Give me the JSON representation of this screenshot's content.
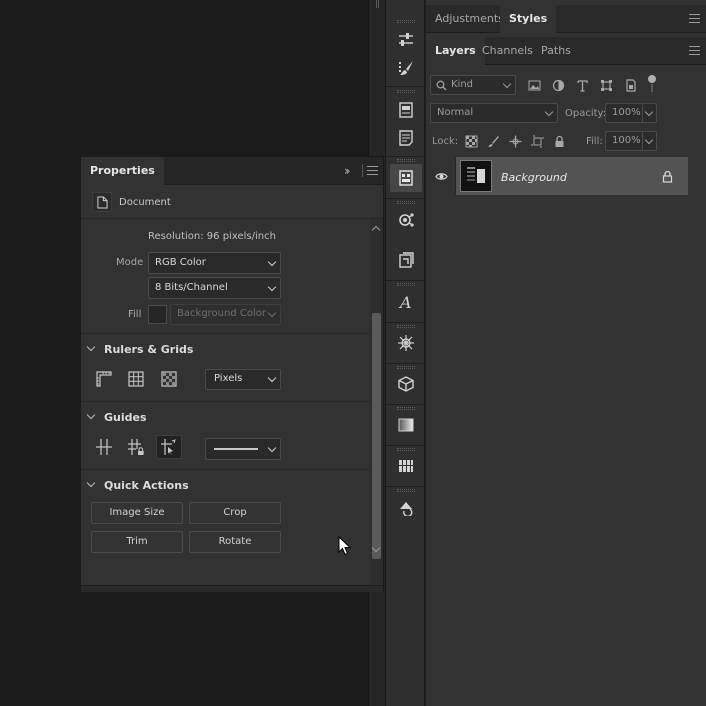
{
  "right_panel": {
    "top_tabs": [
      {
        "label": "Adjustments",
        "active": false
      },
      {
        "label": "Styles",
        "active": true
      }
    ],
    "layer_tabs": [
      {
        "label": "Layers",
        "active": true
      },
      {
        "label": "Channels",
        "active": false
      },
      {
        "label": "Paths",
        "active": false
      }
    ],
    "filter": {
      "kind_label": "Kind",
      "icons": [
        "image-filter-icon",
        "adjustment-filter-icon",
        "type-filter-icon",
        "shape-filter-icon",
        "smart-object-filter-icon",
        "filter-toggle-icon"
      ]
    },
    "blend_mode": "Normal",
    "opacity_label": "Opacity:",
    "opacity_value": "100%",
    "lock_label": "Lock:",
    "fill_label": "Fill:",
    "fill_value": "100%",
    "layers": [
      {
        "name": "Background",
        "visible": true,
        "locked": true
      }
    ]
  },
  "properties": {
    "title": "Properties",
    "doc_label": "Document",
    "resolution": "Resolution: 96 pixels/inch",
    "mode_label": "Mode",
    "mode_value": "RGB Color",
    "bits_value": "8 Bits/Channel",
    "fill_label": "Fill",
    "fill_value": "Background Color",
    "rulers_title": "Rulers & Grids",
    "units_value": "Pixels",
    "guides_title": "Guides",
    "quick_actions_title": "Quick Actions",
    "buttons": {
      "image_size": "Image Size",
      "crop": "Crop",
      "trim": "Trim",
      "rotate": "Rotate"
    }
  },
  "colors": {
    "panel_bg": "#323232",
    "canvas_bg": "#1b1b1b",
    "selected_layer": "#535353",
    "text": "#cfcfcf"
  }
}
